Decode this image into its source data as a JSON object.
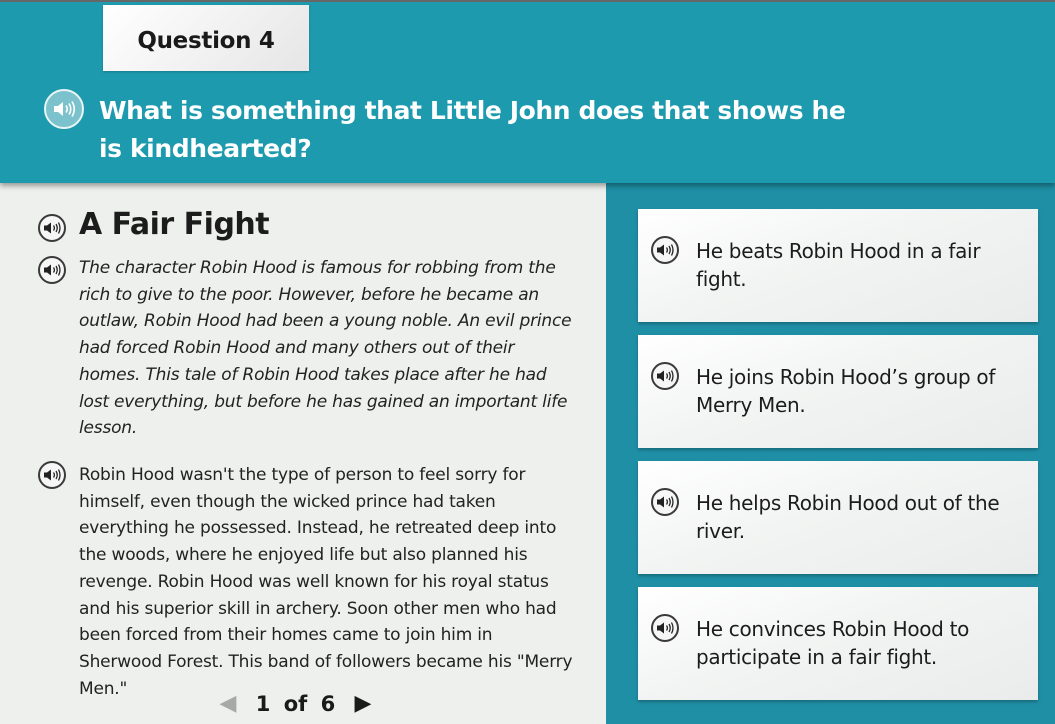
{
  "header": {
    "question_label": "Question 4",
    "question_text": "What is something that Little John does that shows he is kindhearted?",
    "audio_icon": "speaker-icon"
  },
  "passage": {
    "title": "A Fair Fight",
    "paragraphs": [
      {
        "text": "The character Robin Hood is famous for robbing from the rich to give to the poor. However, before he became an outlaw, Robin Hood had been a young noble. An evil prince had forced Robin Hood and many others out of their homes. This tale of Robin Hood takes place after he had lost everything, but before he has gained an important life lesson.",
        "style": "italic"
      },
      {
        "text": "Robin Hood wasn't the type of person to feel sorry for himself, even though the wicked prince had taken everything he possessed. Instead, he retreated deep into the woods, where he enjoyed life but also planned his revenge. Robin Hood was well known for his royal status and his superior skill in archery. Soon other men who had been forced from their homes came to join him in Sherwood Forest. This band of followers became his \"Merry Men.\"",
        "style": "normal"
      }
    ],
    "pager": {
      "label": "1 of 6",
      "prev_icon": "left-triangle-icon",
      "next_icon": "right-triangle-icon"
    }
  },
  "options": [
    {
      "text": "He beats Robin Hood in a fair fight."
    },
    {
      "text": "He joins Robin Hood’s group of Merry Men."
    },
    {
      "text": "He helps Robin Hood out of the river."
    },
    {
      "text": "He convinces Robin Hood to participate in a fair fight."
    }
  ],
  "colors": {
    "header_bg": "#1d9aad",
    "answers_bg": "#1f8fa5",
    "passage_bg": "#edf0ec",
    "card_bg": "#f2f4f3"
  }
}
